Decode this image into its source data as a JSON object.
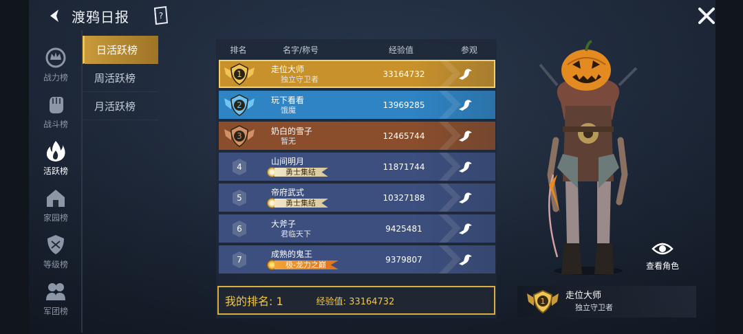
{
  "header": {
    "title": "渡鸦日报"
  },
  "sidebar": {
    "items": [
      {
        "label": "战力榜",
        "icon": "crown-emblem-icon"
      },
      {
        "label": "战斗榜",
        "icon": "fist-icon"
      },
      {
        "label": "活跃榜",
        "icon": "flame-icon",
        "active": true
      },
      {
        "label": "家园榜",
        "icon": "house-icon"
      },
      {
        "label": "等级榜",
        "icon": "shield-icon"
      },
      {
        "label": "军团榜",
        "icon": "group-icon"
      }
    ]
  },
  "subtabs": [
    {
      "label": "日活跃榜",
      "active": true
    },
    {
      "label": "周活跃榜"
    },
    {
      "label": "月活跃榜"
    }
  ],
  "table": {
    "headers": {
      "rank": "排名",
      "name": "名字/称号",
      "exp": "经验值",
      "view": "参观"
    },
    "rows": [
      {
        "rank": "1",
        "name": "走位大师",
        "title": "独立守卫者",
        "badge": "",
        "exp": "33164732",
        "color": "#c8912c"
      },
      {
        "rank": "2",
        "name": "玩下看看",
        "title": "饿魔",
        "badge": "",
        "exp": "13969285",
        "color": "#2f84c4"
      },
      {
        "rank": "3",
        "name": "奶白的雪子",
        "title": "暂无",
        "badge": "",
        "exp": "12465744",
        "color": "#8a4e2c"
      },
      {
        "rank": "4",
        "name": "山间明月",
        "title": "",
        "badge": "勇士集结",
        "badge_style": "warrior",
        "exp": "11871744",
        "color": "#3c4f7e"
      },
      {
        "rank": "5",
        "name": "帝府武式",
        "title": "",
        "badge": "勇士集结",
        "badge_style": "warrior",
        "exp": "10327188",
        "color": "#3c4f7e"
      },
      {
        "rank": "6",
        "name": "大斧子",
        "title": "君临天下",
        "badge": "",
        "exp": "9425481",
        "color": "#3c4f7e"
      },
      {
        "rank": "7",
        "name": "成熟的鬼王",
        "title": "",
        "badge": "极-龙力之巅",
        "badge_style": "dragon",
        "exp": "9379807",
        "color": "#3c4f7e"
      }
    ]
  },
  "my_rank": {
    "label": "我的排名: 1",
    "exp": "经验值: 33164732"
  },
  "character": {
    "view_label": "查看角色",
    "name": "走位大师",
    "title": "独立守卫者",
    "rank": "1"
  }
}
